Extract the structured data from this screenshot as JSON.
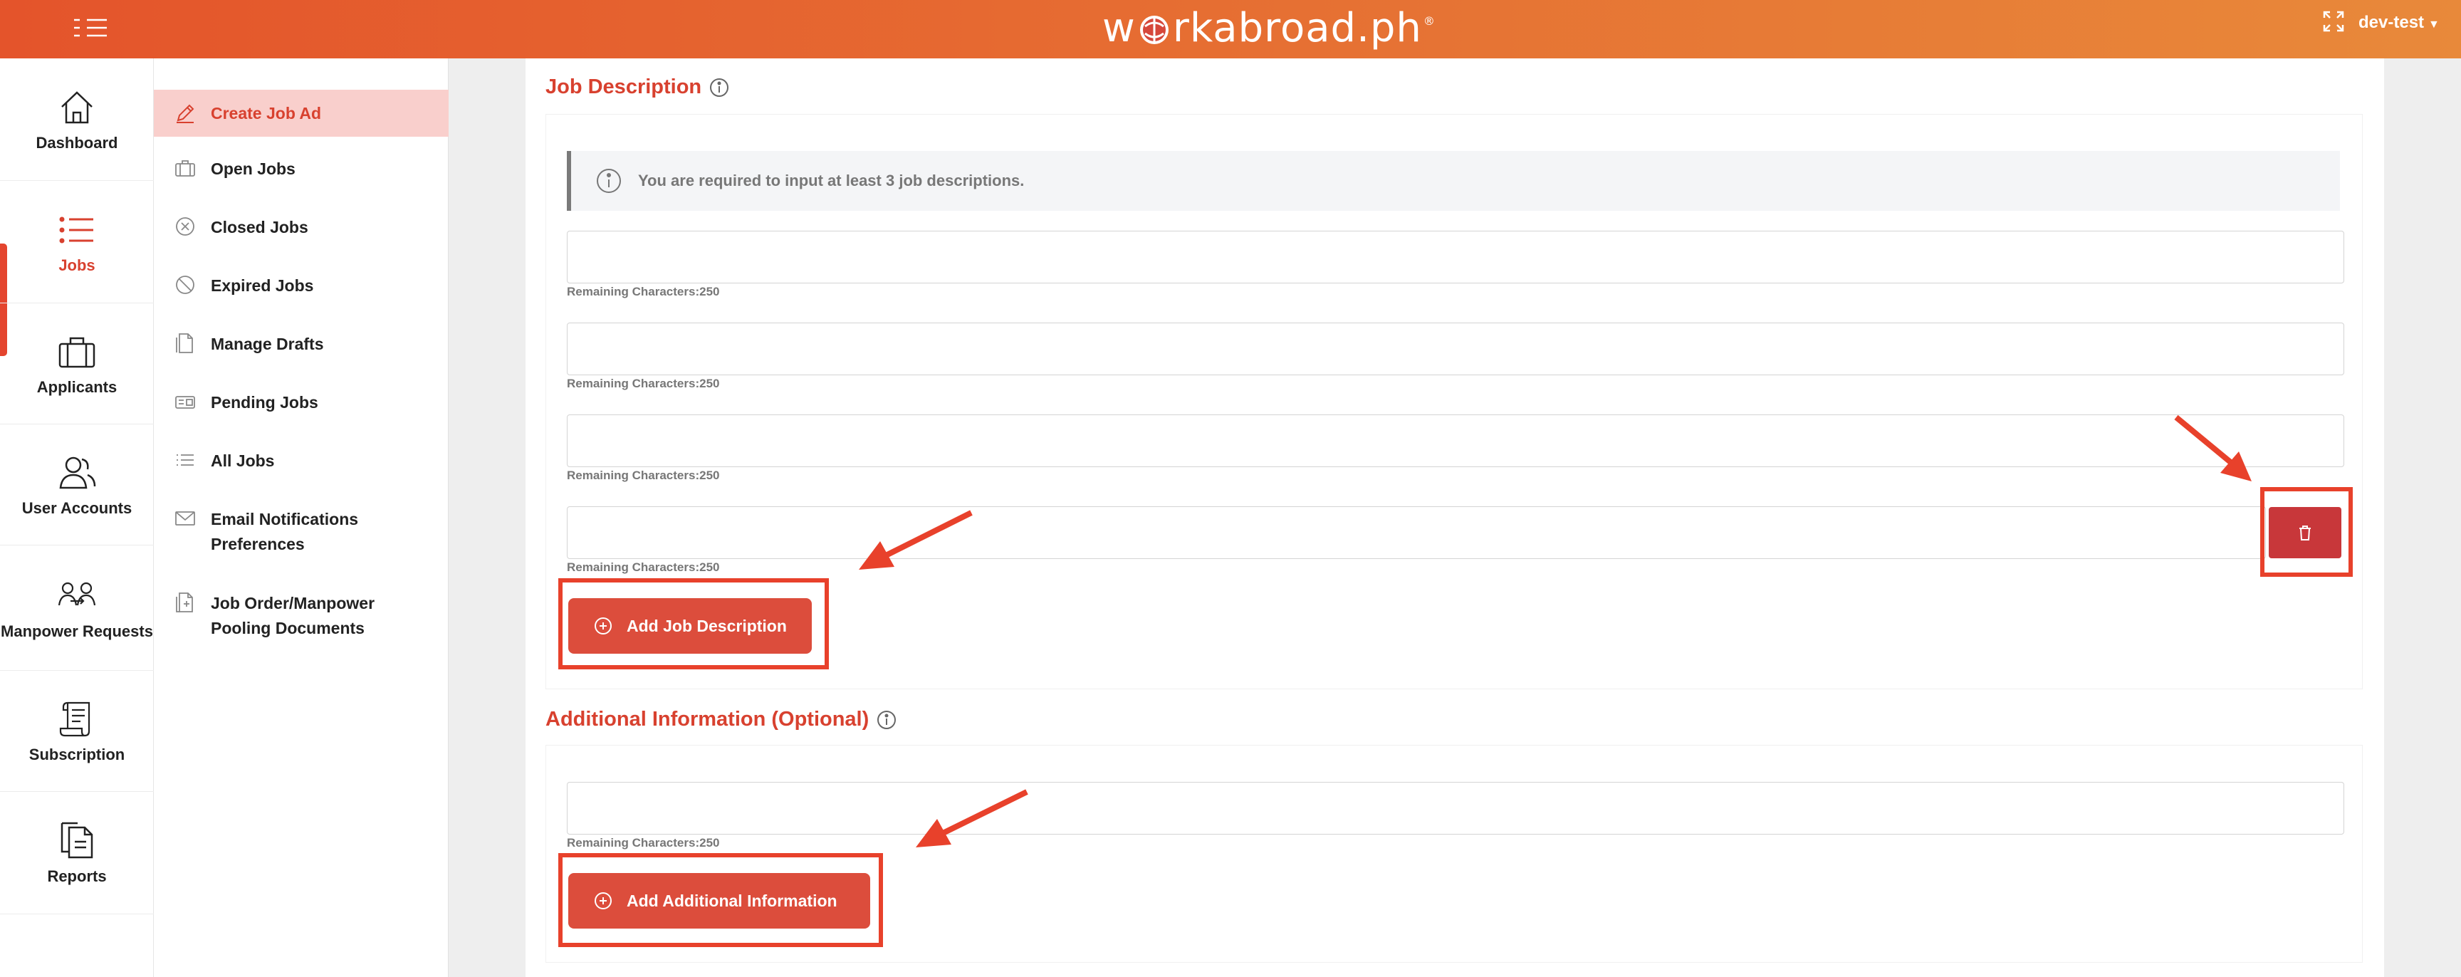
{
  "header": {
    "logo_text_pre": "w",
    "logo_text_post": "rkabroad.ph",
    "logo_trademark": "®",
    "user_name": "dev-test"
  },
  "rail": {
    "items": [
      {
        "label": "Dashboard",
        "icon": "home-icon"
      },
      {
        "label": "Jobs",
        "icon": "list-icon"
      },
      {
        "label": "Applicants",
        "icon": "briefcase-icon"
      },
      {
        "label": "User Accounts",
        "icon": "users-icon"
      },
      {
        "label": "Manpower Requests",
        "icon": "manpower-icon"
      },
      {
        "label": "Subscription",
        "icon": "scroll-icon"
      },
      {
        "label": "Reports",
        "icon": "reports-icon"
      }
    ],
    "active": "Jobs"
  },
  "submenu": {
    "items": [
      {
        "label": "Create Job Ad",
        "icon": "pencil-icon"
      },
      {
        "label": "Open Jobs",
        "icon": "open-jobs-icon"
      },
      {
        "label": "Closed Jobs",
        "icon": "close-circle-icon"
      },
      {
        "label": "Expired Jobs",
        "icon": "ban-icon"
      },
      {
        "label": "Manage Drafts",
        "icon": "draft-icon"
      },
      {
        "label": "Pending Jobs",
        "icon": "pending-icon"
      },
      {
        "label": "All Jobs",
        "icon": "list-icon"
      },
      {
        "label": "Email Notifications Preferences",
        "icon": "envelope-icon"
      },
      {
        "label": "Job Order/Manpower Pooling Documents",
        "icon": "documents-icon"
      }
    ],
    "active": "Create Job Ad"
  },
  "job_description": {
    "title": "Job Description",
    "notice": "You are required to input at least 3 job descriptions.",
    "fields": [
      {
        "value": "",
        "remaining": "Remaining Characters:250"
      },
      {
        "value": "",
        "remaining": "Remaining Characters:250"
      },
      {
        "value": "",
        "remaining": "Remaining Characters:250"
      },
      {
        "value": "",
        "remaining": "Remaining Characters:250"
      }
    ],
    "add_button": "Add Job Description"
  },
  "additional_info": {
    "title": "Additional Information (Optional)",
    "fields": [
      {
        "value": "",
        "remaining": "Remaining Characters:250"
      }
    ],
    "add_button": "Add Additional Information"
  },
  "colors": {
    "brand_orange": "#e4542b",
    "accent_red": "#d8412f",
    "button_red": "#dc4d3c",
    "annotation_red": "#e8412b"
  }
}
